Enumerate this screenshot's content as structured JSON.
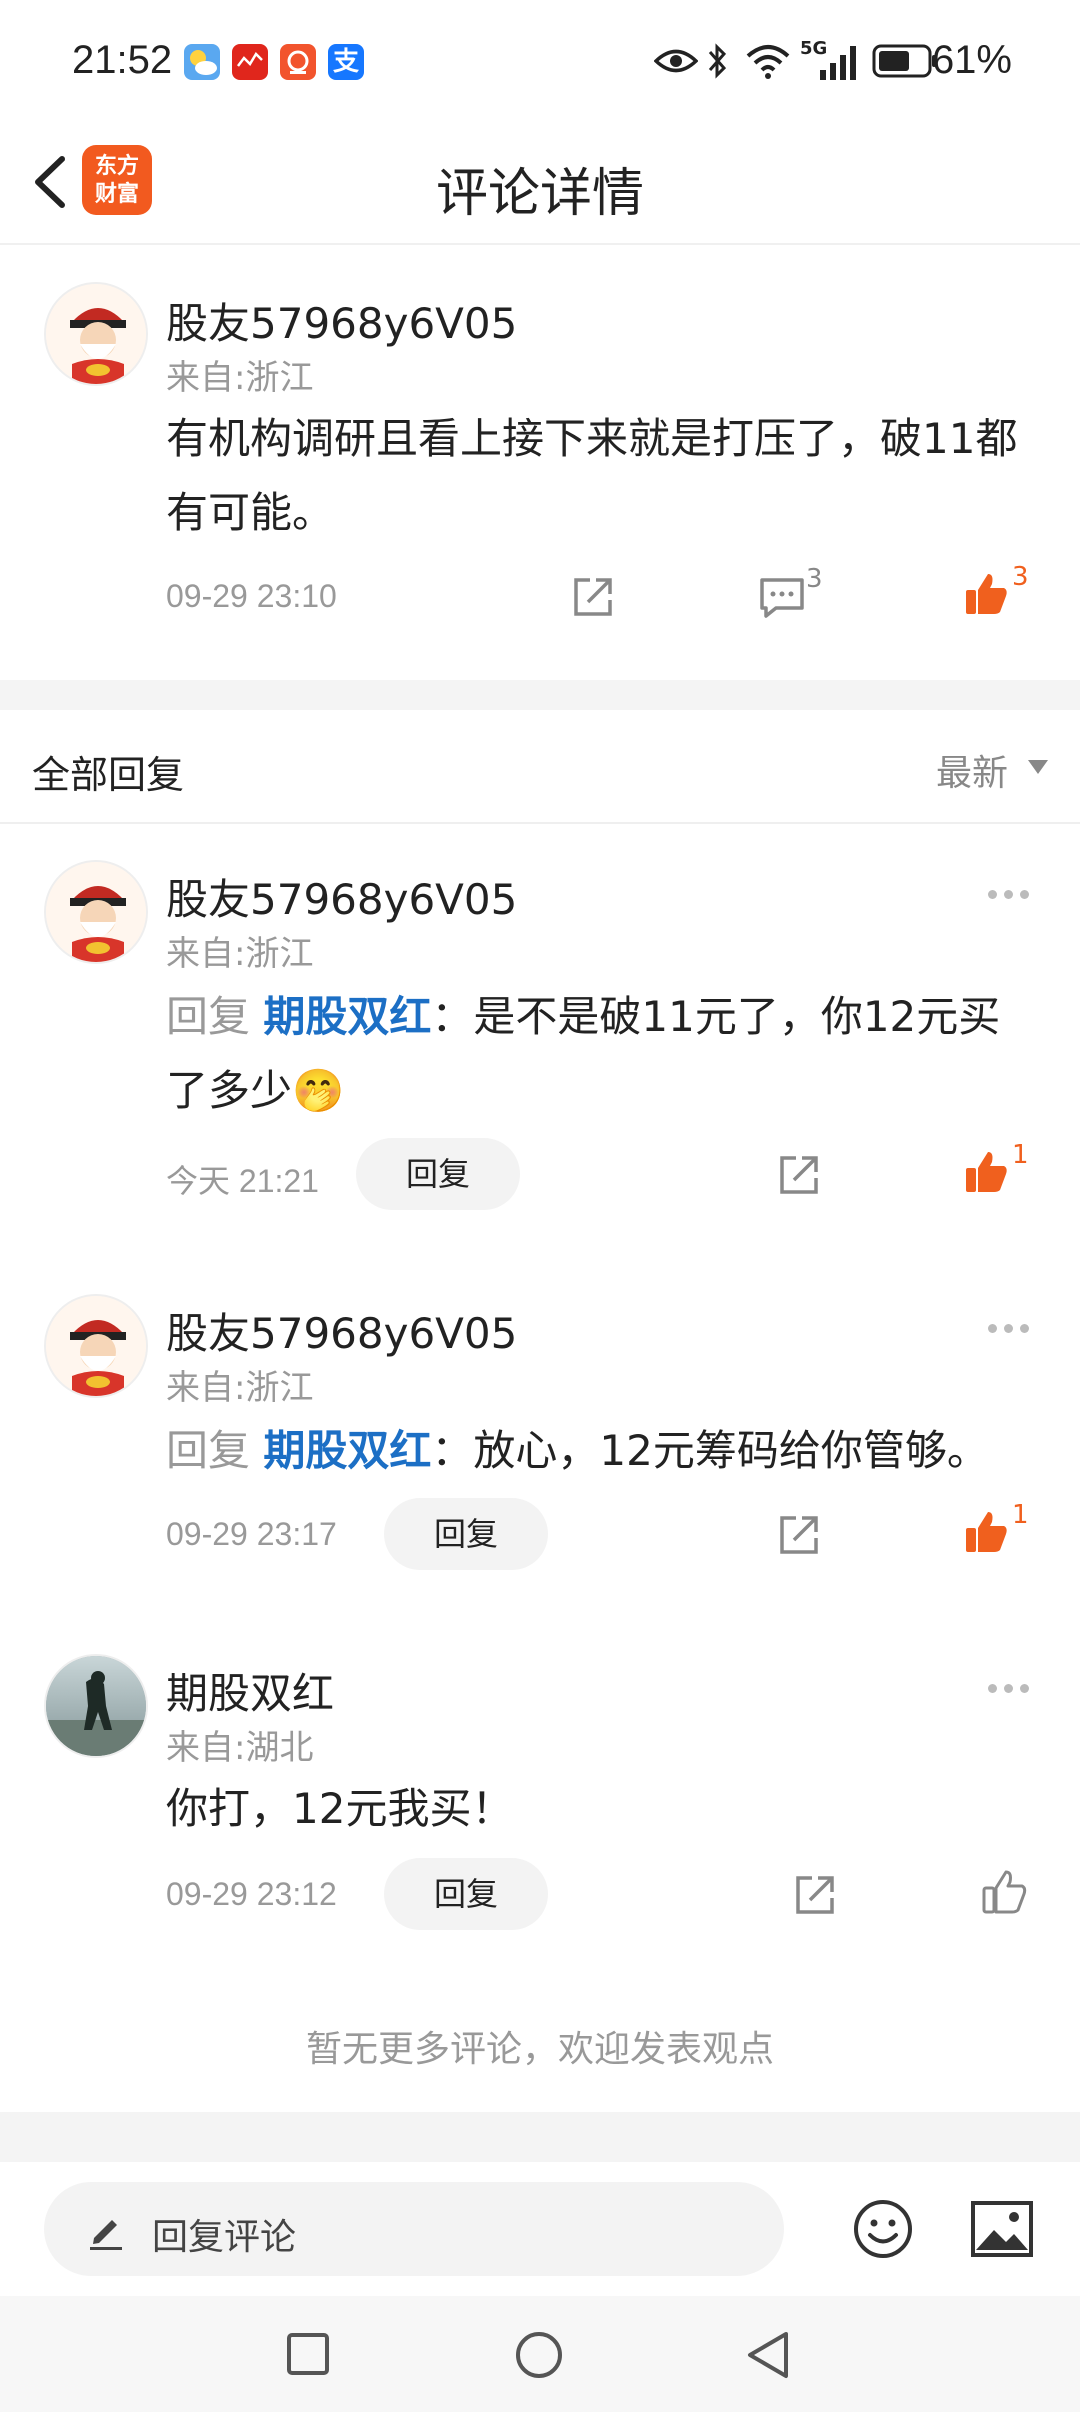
{
  "status_bar": {
    "time": "21:52",
    "battery": "61%",
    "network": "5G",
    "icons": [
      "weather-icon",
      "news-icon",
      "music-icon",
      "alipay-icon",
      "eye-icon",
      "bluetooth-icon",
      "wifi-icon",
      "signal-icon",
      "battery-icon"
    ]
  },
  "header": {
    "title": "评论详情",
    "logo_line1": "东方",
    "logo_line2": "财富"
  },
  "main_comment": {
    "username": "股友57968y6V05",
    "from": "来自:浙江",
    "content": "有机构调研且看上接下来就是打压了，破11都有可能。",
    "time": "09-29 23:10",
    "comment_count": "3",
    "like_count": "3"
  },
  "section": {
    "title": "全部回复",
    "sort": "最新"
  },
  "replies": [
    {
      "username": "股友57968y6V05",
      "from": "来自:浙江",
      "prefix": "回复 ",
      "mention": "期股双红",
      "text": "：是不是破11元了，你12元买了多少🤭",
      "time": "今天 21:21",
      "reply_label": "回复",
      "like_count": "1"
    },
    {
      "username": "股友57968y6V05",
      "from": "来自:浙江",
      "prefix": "回复 ",
      "mention": "期股双红",
      "text": "：放心，12元筹码给你管够。",
      "time": "09-29 23:17",
      "reply_label": "回复",
      "like_count": "1"
    },
    {
      "username": "期股双红",
      "from": "来自:湖北",
      "text": "你打，12元我买！",
      "time": "09-29 23:12",
      "reply_label": "回复"
    }
  ],
  "footer_note": "暂无更多评论，欢迎发表观点",
  "bottom_bar": {
    "placeholder": "回复评论"
  },
  "colors": {
    "accent_orange": "#f25a1f",
    "mention_blue": "#1c6fc5",
    "muted": "#999999"
  }
}
